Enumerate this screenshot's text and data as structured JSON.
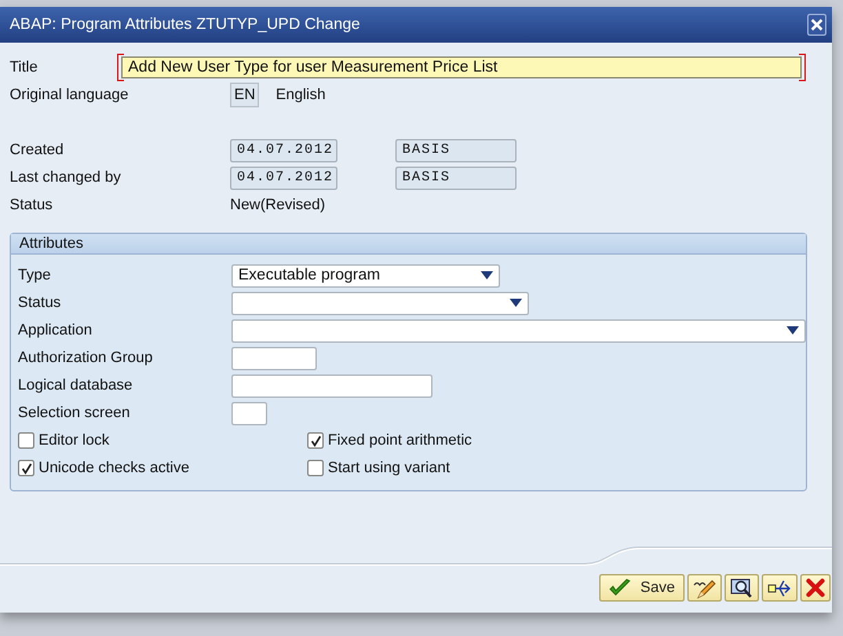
{
  "dialog": {
    "title": "ABAP: Program Attributes ZTUTYP_UPD Change"
  },
  "header_fields": [
    {
      "kind": "title",
      "label": "Title",
      "value": "Add New User Type for user Measurement Price List"
    },
    {
      "kind": "language",
      "label": "Original language",
      "code": "EN",
      "text": "English"
    },
    {
      "kind": "spacer"
    },
    {
      "kind": "pair",
      "label": "Created",
      "date": "04.07.2012",
      "user": "BASIS"
    },
    {
      "kind": "pair",
      "label": "Last changed by",
      "date": "04.07.2012",
      "user": "BASIS"
    },
    {
      "kind": "text",
      "label": "Status",
      "value": "New(Revised)"
    }
  ],
  "attributes": {
    "title": "Attributes",
    "fields": [
      {
        "kind": "dropdown",
        "label": "Type",
        "value": "Executable program"
      },
      {
        "kind": "dropdown",
        "label": "Status"
      },
      {
        "kind": "dropdown",
        "label": "Application"
      },
      {
        "kind": "input",
        "label": "Authorization Group"
      },
      {
        "kind": "input",
        "label": "Logical database"
      },
      {
        "kind": "input",
        "label": "Selection screen"
      }
    ],
    "checkboxes": [
      {
        "label": "Editor lock",
        "checked": false
      },
      {
        "label": "Fixed point arithmetic",
        "checked": true
      },
      {
        "label": "Unicode checks active",
        "checked": true
      },
      {
        "label": "Start using variant",
        "checked": false
      }
    ]
  },
  "buttons": [
    {
      "kind": "save",
      "label": "Save"
    },
    {
      "kind": "edit"
    },
    {
      "kind": "find"
    },
    {
      "kind": "transfer"
    },
    {
      "kind": "cancel"
    }
  ]
}
